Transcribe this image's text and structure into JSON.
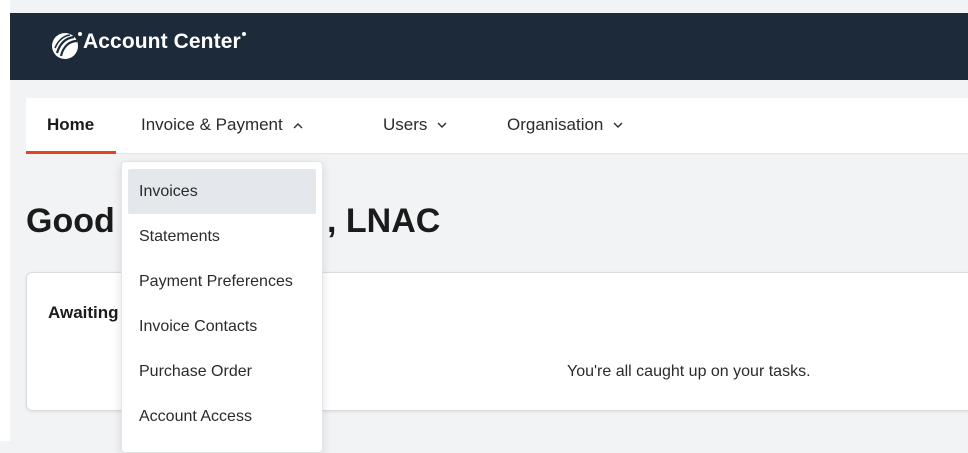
{
  "header": {
    "brand": "Account Center",
    "background": "#1c2a3a"
  },
  "nav": {
    "items": [
      {
        "label": "Home",
        "active": true
      },
      {
        "label": "Invoice & Payment",
        "icon": "chevron-up-icon"
      },
      {
        "label": "Users",
        "icon": "chevron-down-icon"
      },
      {
        "label": "Organisation",
        "icon": "chevron-down-icon"
      }
    ],
    "active_color": "#e2461c"
  },
  "greeting": {
    "prefix": "Good",
    "suffix": ", LNAC"
  },
  "card": {
    "title": "Awaiting",
    "empty_message": "You're all caught up on your tasks."
  },
  "dropdown": {
    "items": [
      {
        "label": "Invoices",
        "highlighted": true
      },
      {
        "label": "Statements"
      },
      {
        "label": "Payment Preferences"
      },
      {
        "label": "Invoice Contacts"
      },
      {
        "label": "Purchase Order"
      },
      {
        "label": "Account Access"
      }
    ]
  }
}
